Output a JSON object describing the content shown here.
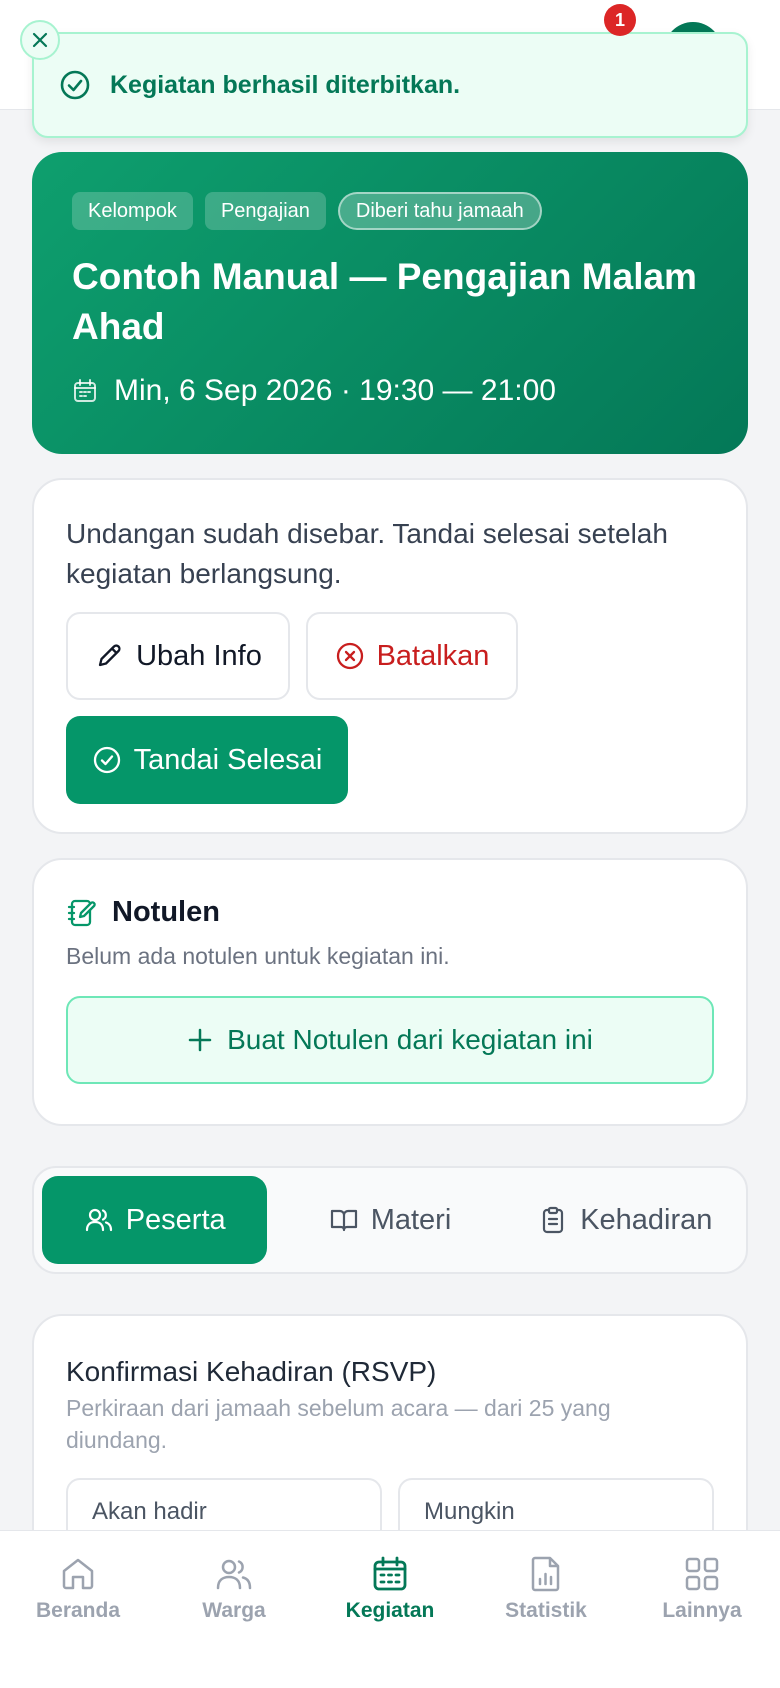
{
  "header": {
    "notification_count": "1"
  },
  "toast": {
    "message": "Kegiatan berhasil diterbitkan."
  },
  "event": {
    "chips": [
      "Kelompok",
      "Pengajian",
      "Diberi tahu jamaah"
    ],
    "title": "Contoh Manual — Pengajian Malam Ahad",
    "datetime": "Min, 6 Sep 2026 · 19:30 — 21:00"
  },
  "status": {
    "message": "Undangan sudah disebar. Tandai selesai setelah kegiatan berlangsung.",
    "edit_label": "Ubah Info",
    "cancel_label": "Batalkan",
    "done_label": "Tandai Selesai"
  },
  "notulen": {
    "title": "Notulen",
    "empty_text": "Belum ada notulen untuk kegiatan ini.",
    "create_label": "Buat Notulen dari kegiatan ini"
  },
  "tabs": {
    "items": [
      {
        "label": "Peserta",
        "active": true
      },
      {
        "label": "Materi",
        "active": false
      },
      {
        "label": "Kehadiran",
        "active": false
      }
    ]
  },
  "rsvp": {
    "title": "Konfirmasi Kehadiran (RSVP)",
    "subtitle": "Perkiraan dari jamaah sebelum acara — dari 25 yang diundang.",
    "boxes": [
      "Akan hadir",
      "Mungkin"
    ]
  },
  "bottom_nav": {
    "items": [
      {
        "label": "Beranda",
        "icon": "home-icon"
      },
      {
        "label": "Warga",
        "icon": "users-icon"
      },
      {
        "label": "Kegiatan",
        "icon": "calendar-icon",
        "active": true
      },
      {
        "label": "Statistik",
        "icon": "chart-file-icon"
      },
      {
        "label": "Lainnya",
        "icon": "grid-icon"
      }
    ]
  },
  "colors": {
    "primary": "#059669",
    "primary_dark": "#047857",
    "danger": "#c81e1e",
    "toast_bg": "#ecfdf5"
  }
}
